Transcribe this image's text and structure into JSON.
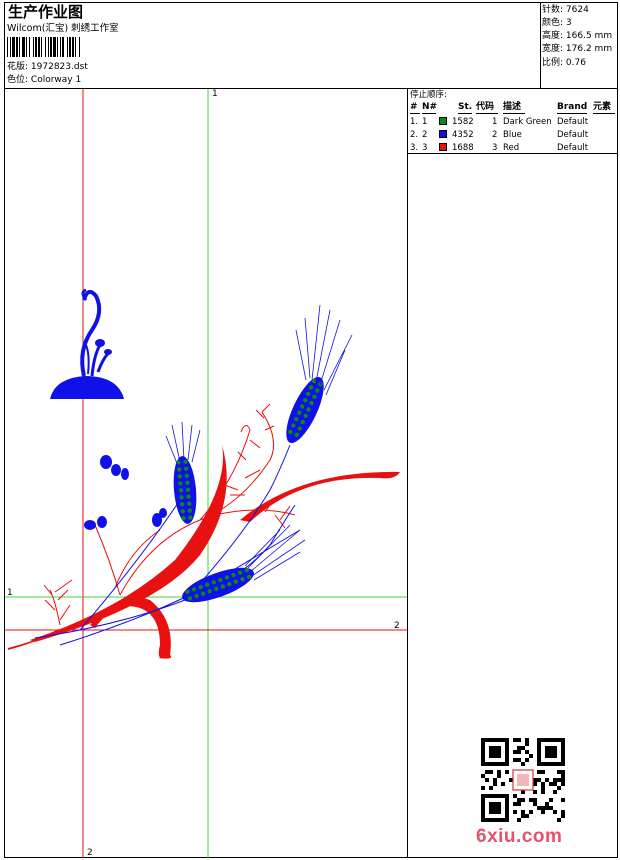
{
  "header": {
    "title": "生产作业图",
    "studio": "Wilcom(汇宝) 刺绣工作室",
    "design_label": "花版:",
    "design_file": "1972823.dst",
    "color_label": "色位:",
    "colorway": "Colorway 1"
  },
  "specs": [
    {
      "label": "针数:",
      "value": "7624"
    },
    {
      "label": "颜色:",
      "value": "3"
    },
    {
      "label": "高度:",
      "value": "166.5 mm"
    },
    {
      "label": "宽度:",
      "value": "176.2 mm"
    },
    {
      "label": "比例:",
      "value": "0.76"
    }
  ],
  "stop_sequence": {
    "title": "停止顺序:",
    "headers": {
      "num": "#",
      "needle": "N#",
      "stitches": "St.",
      "code": "代码",
      "desc": "描述",
      "brand": "Brand",
      "element": "元素"
    },
    "rows": [
      {
        "num": "1.",
        "needle": "1",
        "color": "#0a8a12",
        "stitches": "1582",
        "code": "1",
        "desc": "Dark Green",
        "brand": "Default"
      },
      {
        "num": "2.",
        "needle": "2",
        "color": "#1010e8",
        "stitches": "4352",
        "code": "2",
        "desc": "Blue",
        "brand": "Default"
      },
      {
        "num": "3.",
        "needle": "3",
        "color": "#e81010",
        "stitches": "1688",
        "code": "3",
        "desc": "Red",
        "brand": "Default"
      }
    ]
  },
  "axes": {
    "green_v_label": "1",
    "green_h_label": "1",
    "red_h_label": "2",
    "red_v_label": "2"
  },
  "watermark": "6xiu.com",
  "colors": {
    "green": "#0a8a12",
    "blue": "#1010e8",
    "red": "#e81010",
    "guide_green": "#39d839",
    "guide_red": "#e81010"
  }
}
